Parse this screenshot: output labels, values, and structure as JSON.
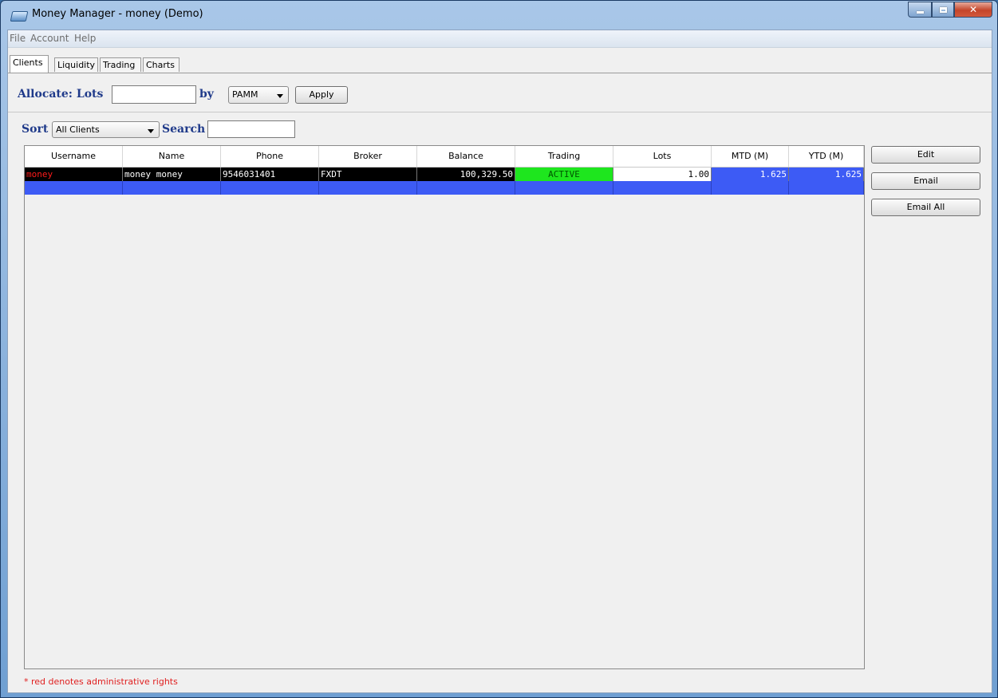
{
  "window": {
    "title": "Money Manager - money (Demo)"
  },
  "menu": [
    "File",
    "Account",
    "Help"
  ],
  "tabs": [
    "Clients",
    "Liquidity",
    "Trading",
    "Charts"
  ],
  "allocate": {
    "label": "Allocate: Lots",
    "lots_value": "",
    "by_label": "by",
    "method": "PAMM",
    "apply_label": "Apply"
  },
  "filter": {
    "sort_label": "Sort",
    "sort_value": "All Clients",
    "search_label": "Search",
    "search_value": ""
  },
  "table": {
    "columns": [
      "Username",
      "Name",
      "Phone",
      "Broker",
      "Balance",
      "Trading",
      "Lots",
      "MTD (M)",
      "YTD (M)"
    ],
    "rows": [
      {
        "username": "money",
        "name": "money money",
        "phone": "9546031401",
        "broker": "FXDT",
        "balance": "100,329.50",
        "trading": "ACTIVE",
        "lots": "1.00",
        "mtd": "1.625",
        "ytd": "1.625"
      }
    ]
  },
  "actions": {
    "edit": "Edit",
    "email": "Email",
    "email_all": "Email All"
  },
  "footnote": "* red denotes administrative rights",
  "colors": {
    "admin_red": "#ff1a1a",
    "active_green": "#1ee61e",
    "selection_blue": "#3d5bf5",
    "label_navy": "#1f3a8a"
  }
}
